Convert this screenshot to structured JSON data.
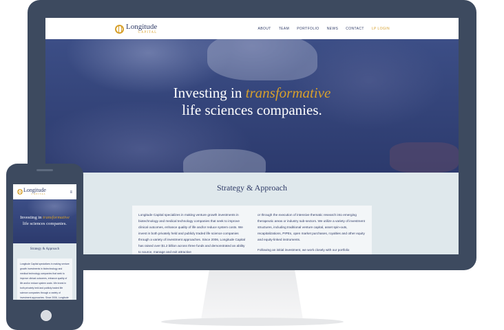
{
  "logo": {
    "name": "Longitude",
    "sub": "CAPITAL"
  },
  "nav": {
    "items": [
      "ABOUT",
      "TEAM",
      "PORTFOLIO",
      "NEWS",
      "CONTACT"
    ],
    "lp_login": "LP LOGIN"
  },
  "hero": {
    "line1_prefix": "Investing in ",
    "line1_accent": "transformative",
    "line2": "life sciences companies."
  },
  "strategy": {
    "title": "Strategy & Approach",
    "left_text": "Longitude Capital specializes in making venture growth investments in biotechnology and medical technology companies that seek to improve clinical outcomes, enhance quality of life and/or reduce system costs. We invest in both privately held and publicly traded life science companies through a variety of investment approaches. Since 2006, Longitude Capital has raised over $1.2 billion across three funds and demonstrated an ability to source, manage and exit attractive",
    "right_text": "or through the execution of intensive thematic research into emerging therapeutic areas or industry sub-sectors. We utilize a variety of investment structures, including traditional venture capital, asset spin-outs, recapitalizations, PIPEs, open market purchases, royalties and other equity and equity-linked instruments.",
    "right_text2": "Following an initial investment, we work closely with our portfolio"
  },
  "mobile": {
    "menu_icon": "hamburger-icon",
    "strategy_title": "Strategy & Approach",
    "card_text": "Longitude Capital specializes in making venture growth investments in biotechnology and medical technology companies that seek to improve clinical outcomes, enhance quality of life and/or reduce system costs. We invest in both privately held and publicly traded life science companies through a variety of investment approaches. Since 2006, Longitude Capital has"
  },
  "colors": {
    "navy": "#2e3a66",
    "gold": "#d7a02c",
    "device": "#3d4a5f"
  }
}
